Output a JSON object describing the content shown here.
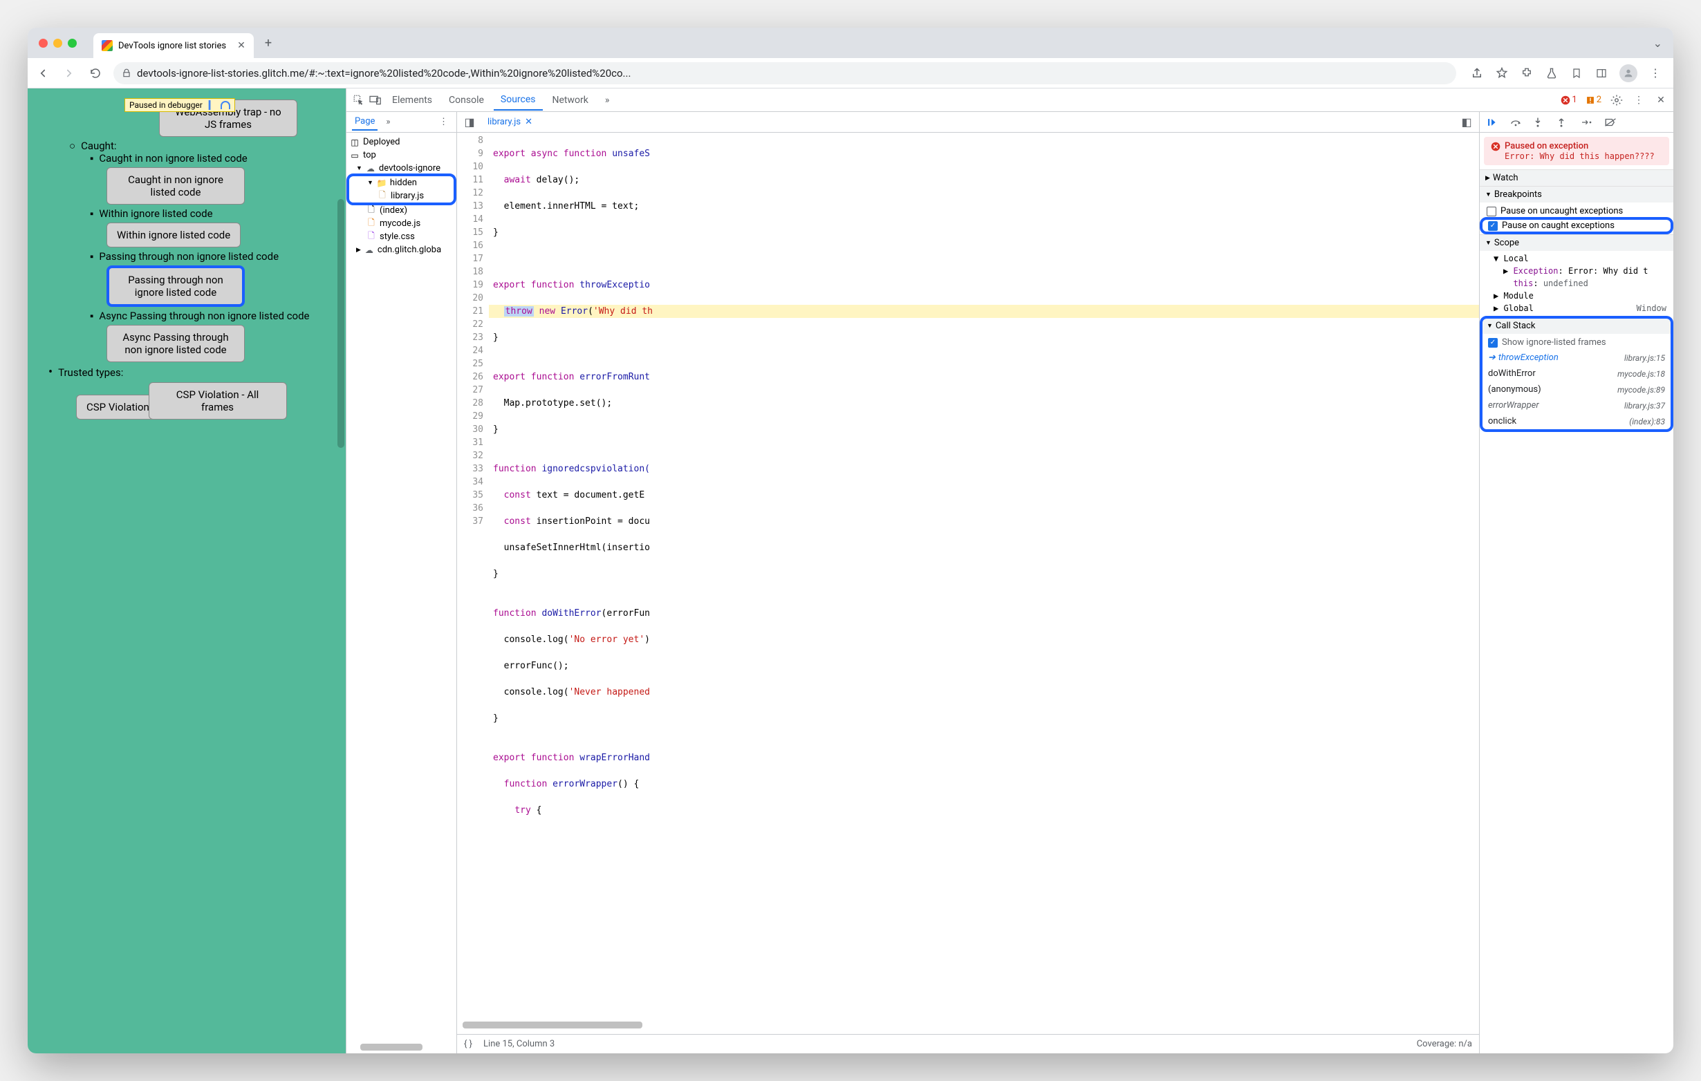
{
  "browser": {
    "tab_title": "DevTools ignore list stories",
    "url": "devtools-ignore-list-stories.glitch.me/#:~:text=ignore%20listed%20code-,Within%20ignore%20listed%20co..."
  },
  "page": {
    "paused_label": "Paused in debugger",
    "items": {
      "wasm": "WebAssembly trap - no JS frames",
      "caught_heading": "Caught:",
      "caught_non_ignore": "Caught in non ignore listed code",
      "caught_non_ignore_btn": "Caught in non ignore listed code",
      "within_ignore": "Within ignore listed code",
      "within_ignore_btn": "Within ignore listed code",
      "passing": "Passing through non ignore listed code",
      "passing_btn": "Passing through non ignore listed code",
      "async_passing": "Async Passing through non ignore listed code",
      "async_passing_btn": "Async Passing through non ignore listed code",
      "trusted": "Trusted types:",
      "csp1": "CSP Violation",
      "csp2": "CSP Violation - All frames"
    }
  },
  "devtools": {
    "tabs": {
      "elements": "Elements",
      "console": "Console",
      "sources": "Sources",
      "network": "Network"
    },
    "errors": "1",
    "warnings": "2",
    "navigator": {
      "page_tab": "Page",
      "deployed": "Deployed",
      "top": "top",
      "origin": "devtools-ignore",
      "hidden": "hidden",
      "library": "library.js",
      "index": "(index)",
      "mycode": "mycode.js",
      "style": "style.css",
      "cdn": "cdn.glitch.globa"
    },
    "editor": {
      "filename": "library.js",
      "lines": {
        "8": "export async function unsafeS",
        "9": "  await delay();",
        "10": "  element.innerHTML = text;",
        "11": "}",
        "12": "",
        "13": "",
        "14": "export function throwExceptio",
        "15_throw": "throw",
        "15_rest": " new Error('Why did th",
        "16": "}",
        "17": "",
        "18": "export function errorFromRunt",
        "19": "  Map.prototype.set();",
        "20": "}",
        "21": "",
        "22": "function ignoredcspviolation(",
        "23": "  const text = document.getE",
        "24": "  const insertionPoint = docu",
        "25": "  unsafeSetInnerHtml(insertio",
        "26": "}",
        "27": "",
        "28": "function doWithError(errorFun",
        "29": "  console.log('No error yet')",
        "30": "  errorFunc();",
        "31": "  console.log('Never happened",
        "32": "}",
        "33": "",
        "34": "export function wrapErrorHand",
        "35": "  function errorWrapper() {",
        "36": "    try {"
      },
      "status_line": "Line 15, Column 3",
      "status_coverage": "Coverage: n/a"
    },
    "debugger": {
      "pause_title": "Paused on exception",
      "pause_error": "Error: Why did this happen????",
      "watch": "Watch",
      "breakpoints": "Breakpoints",
      "bp_uncaught": "Pause on uncaught exceptions",
      "bp_caught": "Pause on caught exceptions",
      "scope": "Scope",
      "local": "Local",
      "exception_label": "Exception",
      "exception_val": "Error: Why did t",
      "this_label": "this",
      "this_val": "undefined",
      "module": "Module",
      "global": "Global",
      "global_val": "Window",
      "callstack": "Call Stack",
      "show_ignore": "Show ignore-listed frames",
      "frames": [
        {
          "fn": "throwException",
          "loc": "library.js:15",
          "current": true,
          "italic": true
        },
        {
          "fn": "doWithError",
          "loc": "mycode.js:18",
          "current": false,
          "italic": false
        },
        {
          "fn": "(anonymous)",
          "loc": "mycode.js:89",
          "current": false,
          "italic": false
        },
        {
          "fn": "errorWrapper",
          "loc": "library.js:37",
          "current": false,
          "italic": true
        },
        {
          "fn": "onclick",
          "loc": "(index):83",
          "current": false,
          "italic": false
        }
      ]
    }
  }
}
